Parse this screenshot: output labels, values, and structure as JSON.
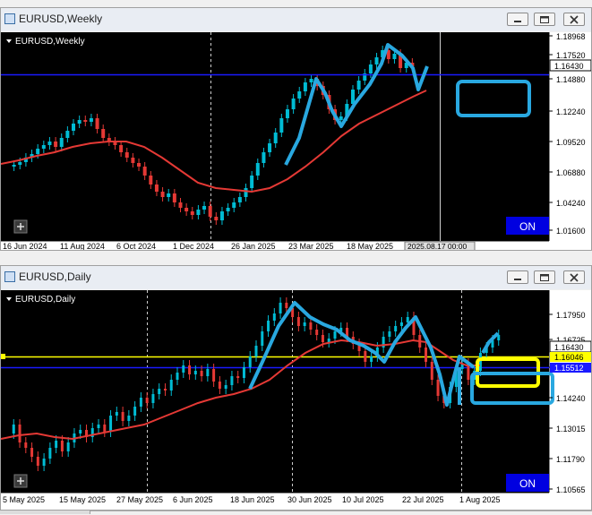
{
  "weekly": {
    "window_title": "EURUSD,Weekly",
    "symbol_label": "EURUSD,Weekly",
    "price_labels": [
      "1.18968",
      "1.17520",
      "1.14880",
      "1.12240",
      "1.09520",
      "1.06880",
      "1.04240",
      "1.01600"
    ],
    "current_price": "1.16430",
    "date_labels": [
      "16 Jun 2024",
      "11 Aug 2024",
      "6 Oct 2024",
      "1 Dec 2024",
      "26 Jan 2025",
      "23 Mar 2025",
      "18 May 2025"
    ],
    "crosshair_date": "2025.08.17 00:00",
    "on_label": "ON",
    "plus_icon": "plus-icon"
  },
  "daily": {
    "window_title": "EURUSD,Daily",
    "symbol_label": "EURUSD,Daily",
    "price_labels": [
      "1.17950",
      "1.16725",
      "1.15512",
      "1.14240",
      "1.13015",
      "1.11790",
      "1.10565"
    ],
    "current_price": "1.16430",
    "yellow_price": "1.16046",
    "blue_price": "1.15512",
    "date_labels": [
      "5 May 2025",
      "15 May 2025",
      "27 May 2025",
      "6 Jun 2025",
      "18 Jun 2025",
      "30 Jun 2025",
      "10 Jul 2025",
      "22 Jul 2025",
      "1 Aug 2025"
    ],
    "on_label": "ON",
    "plus_icon": "plus-icon"
  },
  "colors": {
    "bull": "#00bcd4",
    "bear": "#e53935",
    "ma": "#e53935",
    "annotation": "#29a8e0",
    "hline_blue": "#1a1aff",
    "hline_yellow": "#ffff00",
    "on_button": "#0000e0"
  },
  "window_buttons": [
    "minimize-icon",
    "restore-icon",
    "close-icon"
  ]
}
